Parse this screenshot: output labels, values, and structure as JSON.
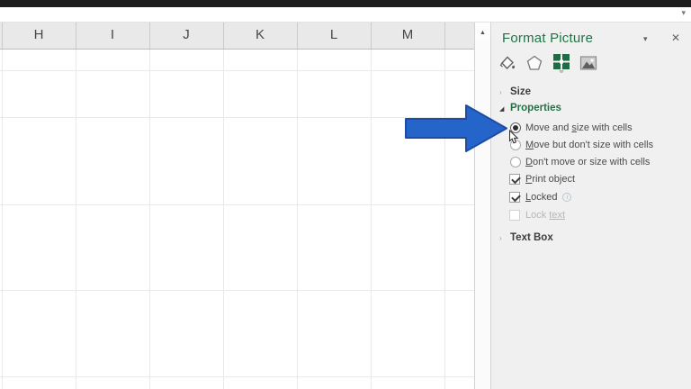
{
  "titlebar": {
    "collapse_caret": "▾"
  },
  "sheet": {
    "columns": [
      "H",
      "I",
      "J",
      "K",
      "L",
      "M"
    ]
  },
  "scrollbar": {
    "up_arrow": "▲"
  },
  "pane": {
    "title": "Format Picture",
    "caret": "▾",
    "close": "✕",
    "tabs": [
      {
        "name": "Fill & Line",
        "selected": false
      },
      {
        "name": "Effects",
        "selected": false
      },
      {
        "name": "Size & Properties",
        "selected": true
      },
      {
        "name": "Picture",
        "selected": false
      }
    ],
    "sections": {
      "size": {
        "label": "Size",
        "twist": "›",
        "expanded": false
      },
      "properties": {
        "label": "Properties",
        "twist": "◢",
        "expanded": true
      },
      "textbox": {
        "label": "Text Box",
        "twist": "›",
        "expanded": false
      }
    },
    "options": {
      "radios": [
        {
          "pre": "Move and ",
          "accel": "s",
          "post": "ize with cells",
          "selected": true
        },
        {
          "pre": "",
          "accel": "M",
          "post": "ove but don't size with cells",
          "selected": false
        },
        {
          "pre": "",
          "accel": "D",
          "post": "on't move or size with cells",
          "selected": false
        }
      ],
      "checks": [
        {
          "pre": "",
          "accel": "P",
          "post": "rint object",
          "checked": true,
          "disabled": false
        },
        {
          "pre": "",
          "accel": "L",
          "post": "ocked",
          "checked": true,
          "disabled": false,
          "info_glyph": "i"
        },
        {
          "pre": "Lock ",
          "accel": "text",
          "post": "",
          "checked": false,
          "disabled": true
        }
      ]
    }
  },
  "annotation": {
    "arrow_fill": "#2565c9",
    "arrow_outline": "#1c4da6"
  }
}
